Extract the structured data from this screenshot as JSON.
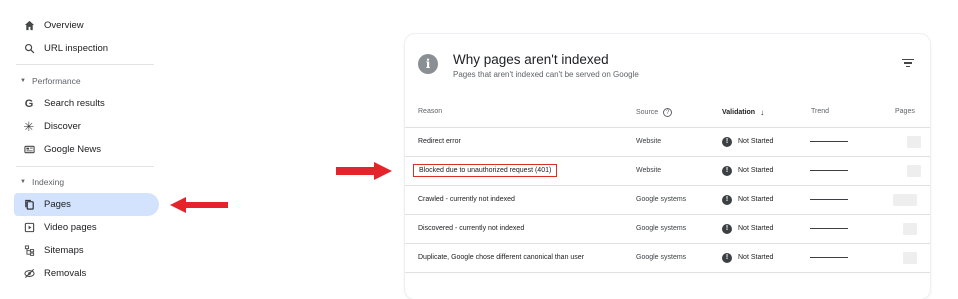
{
  "sidebar": {
    "items_top": [
      {
        "label": "Overview",
        "icon": "home-icon"
      },
      {
        "label": "URL inspection",
        "icon": "search-icon"
      }
    ],
    "sections": [
      {
        "title": "Performance",
        "items": [
          {
            "label": "Search results",
            "icon": "google-g-icon"
          },
          {
            "label": "Discover",
            "icon": "asterisk-icon"
          },
          {
            "label": "Google News",
            "icon": "news-icon"
          }
        ]
      },
      {
        "title": "Indexing",
        "items": [
          {
            "label": "Pages",
            "icon": "pages-icon",
            "active": true
          },
          {
            "label": "Video pages",
            "icon": "video-pages-icon"
          },
          {
            "label": "Sitemaps",
            "icon": "sitemaps-icon"
          },
          {
            "label": "Removals",
            "icon": "removals-icon"
          }
        ]
      }
    ]
  },
  "annotations": {
    "arrow_color": "#e3242b",
    "highlight_color": "#d93025"
  },
  "card": {
    "icon": "info-icon",
    "title": "Why pages aren't indexed",
    "subtitle": "Pages that aren't indexed can't be served on Google",
    "columns": {
      "reason": "Reason",
      "source": "Source",
      "validation": "Validation",
      "trend": "Trend",
      "pages": "Pages"
    },
    "rows": [
      {
        "reason": "Redirect error",
        "source": "Website",
        "validation": "Not Started"
      },
      {
        "reason": "Blocked due to unauthorized request (401)",
        "source": "Website",
        "validation": "Not Started",
        "highlighted": true
      },
      {
        "reason": "Crawled - currently not indexed",
        "source": "Google systems",
        "validation": "Not Started"
      },
      {
        "reason": "Discovered - currently not indexed",
        "source": "Google systems",
        "validation": "Not Started"
      },
      {
        "reason": "Duplicate, Google chose different canonical than user",
        "source": "Google systems",
        "validation": "Not Started"
      }
    ]
  }
}
